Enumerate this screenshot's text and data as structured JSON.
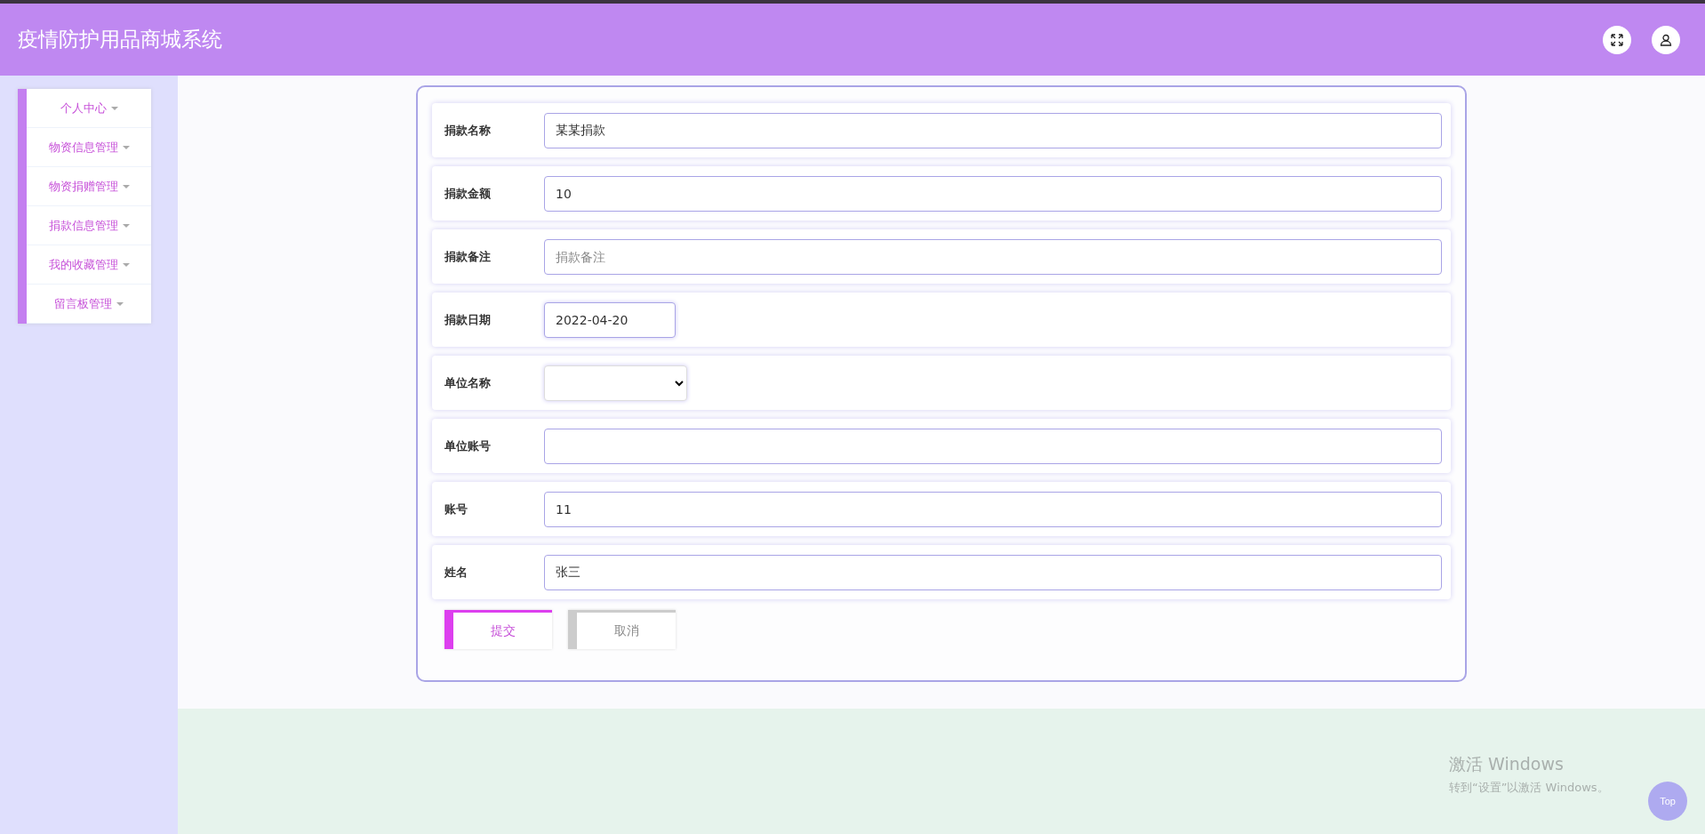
{
  "header": {
    "title": "疫情防护用品商城系统"
  },
  "sidebar": {
    "items": [
      {
        "label": "个人中心",
        "expanded": false
      },
      {
        "label": "物资信息管理",
        "expanded": false
      },
      {
        "label": "物资捐赠管理",
        "expanded": false
      },
      {
        "label": "捐款信息管理",
        "expanded": false
      },
      {
        "label": "我的收藏管理",
        "expanded": false
      },
      {
        "label": "留言板管理",
        "expanded": false
      }
    ]
  },
  "form": {
    "fields": [
      {
        "kind": "text",
        "label": "捐款名称",
        "value": "某某捐款"
      },
      {
        "kind": "text",
        "label": "捐款金额",
        "value": "10"
      },
      {
        "kind": "text",
        "label": "捐款备注",
        "placeholder": "捐款备注"
      },
      {
        "kind": "date",
        "label": "捐款日期",
        "value": "2022-04-20"
      },
      {
        "kind": "select",
        "label": "单位名称"
      },
      {
        "kind": "text",
        "label": "单位账号"
      },
      {
        "kind": "text",
        "label": "账号",
        "value": "11"
      },
      {
        "kind": "text",
        "label": "姓名",
        "value": "张三"
      }
    ],
    "buttons": [
      {
        "kind": "primary",
        "label": "提交"
      },
      {
        "kind": "secondary",
        "label": "取消"
      }
    ]
  },
  "os_notice": {
    "title": "激活 Windows",
    "text": "转到“设置”以激活 Windows。"
  },
  "top_button": "Top"
}
